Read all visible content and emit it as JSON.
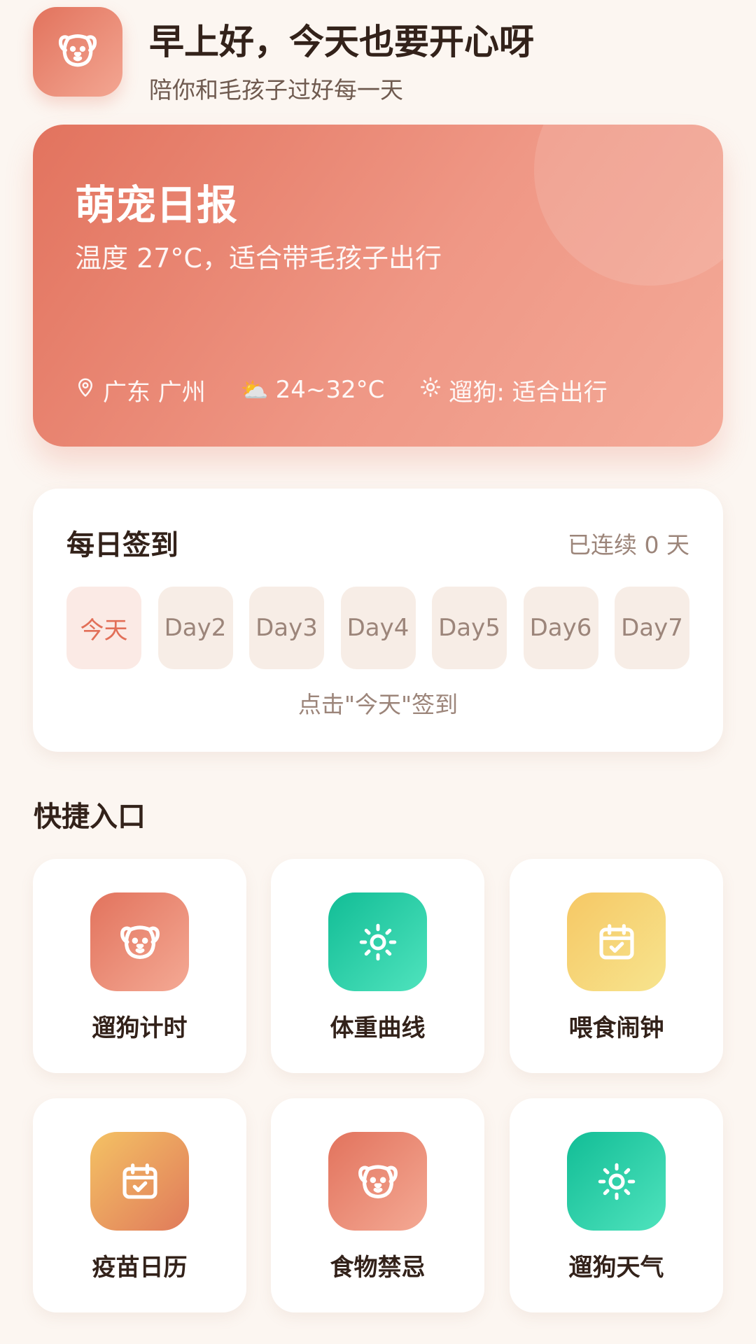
{
  "header": {
    "greeting": "早上好，今天也要开心呀",
    "subtitle": "陪你和毛孩子过好每一天",
    "avatar_icon": "dog-face-icon"
  },
  "report": {
    "title": "萌宠日报",
    "subtitle": "温度 27°C，适合带毛孩子出行",
    "location": "广东 广州",
    "weather_emoji": "⛅",
    "temp_range": "24~32°C",
    "walk_status": "遛狗: 适合出行"
  },
  "checkin": {
    "title": "每日签到",
    "streak": "已连续 0 天",
    "days": [
      "今天",
      "Day2",
      "Day3",
      "Day4",
      "Day5",
      "Day6",
      "Day7"
    ],
    "hint": "点击\"今天\"签到"
  },
  "quick": {
    "title": "快捷入口",
    "items": [
      {
        "label": "遛狗计时",
        "icon": "dog-face-icon",
        "color": "#e2735d"
      },
      {
        "label": "体重曲线",
        "icon": "sun-icon",
        "color": "#12bd96"
      },
      {
        "label": "喂食闹钟",
        "icon": "calendar-check-icon",
        "color": "#f6c865"
      },
      {
        "label": "疫苗日历",
        "icon": "calendar-check-icon",
        "color": "#eea25f"
      },
      {
        "label": "食物禁忌",
        "icon": "dog-face-icon",
        "color": "#e2735d"
      },
      {
        "label": "遛狗天气",
        "icon": "sun-icon",
        "color": "#12bd96"
      }
    ]
  },
  "colors": {
    "background": "#fcf6f1",
    "accent": "#e2735d",
    "muted_text": "#9c857a"
  }
}
